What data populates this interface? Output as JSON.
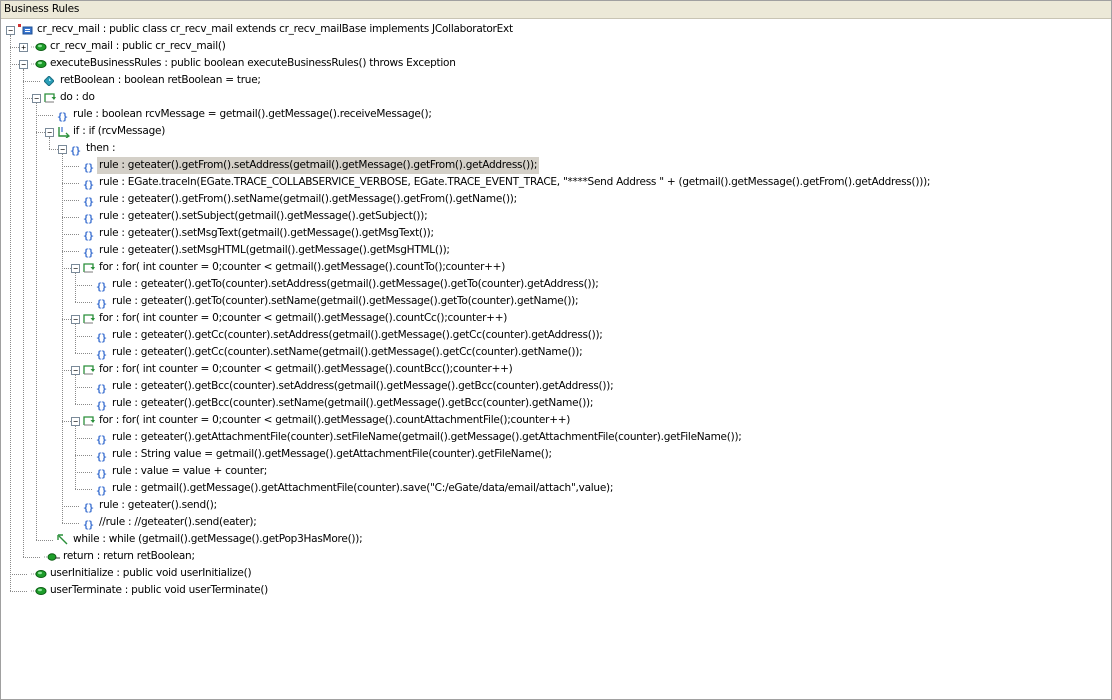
{
  "window": {
    "title": "Business Rules"
  },
  "tree": [
    {
      "id": "class",
      "depth": 0,
      "icon": "class-icon",
      "toggle": "minus",
      "text": "cr_recv_mail : public class cr_recv_mail extends cr_recv_mailBase implements JCollaboratorExt"
    },
    {
      "id": "ctor",
      "depth": 1,
      "icon": "method-icon",
      "toggle": "plus",
      "text": "cr_recv_mail : public  cr_recv_mail()"
    },
    {
      "id": "exec",
      "depth": 1,
      "icon": "method-icon",
      "toggle": "minus",
      "text": "executeBusinessRules : public boolean executeBusinessRules() throws Exception"
    },
    {
      "id": "retbool",
      "depth": 2,
      "icon": "variable-icon",
      "text": "retBoolean : boolean retBoolean = true;"
    },
    {
      "id": "do",
      "depth": 2,
      "icon": "loop-icon",
      "toggle": "minus",
      "text": "do : do"
    },
    {
      "id": "r1",
      "depth": 3,
      "icon": "rule-icon",
      "text": "rule : boolean rcvMessage = getmail().getMessage().receiveMessage();"
    },
    {
      "id": "if",
      "depth": 3,
      "icon": "if-icon",
      "toggle": "minus",
      "text": "if : if (rcvMessage)"
    },
    {
      "id": "then",
      "depth": 4,
      "icon": "rule-icon",
      "toggle": "minus",
      "text": "then :"
    },
    {
      "id": "r2",
      "depth": 5,
      "icon": "rule-icon",
      "selected": true,
      "text": "rule : geteater().getFrom().setAddress(getmail().getMessage().getFrom().getAddress());"
    },
    {
      "id": "r3",
      "depth": 5,
      "icon": "rule-icon",
      "text": "rule : EGate.traceln(EGate.TRACE_COLLABSERVICE_VERBOSE, EGate.TRACE_EVENT_TRACE, \"****Send Address \" + (getmail().getMessage().getFrom().getAddress()));"
    },
    {
      "id": "r4",
      "depth": 5,
      "icon": "rule-icon",
      "text": "rule : geteater().getFrom().setName(getmail().getMessage().getFrom().getName());"
    },
    {
      "id": "r5",
      "depth": 5,
      "icon": "rule-icon",
      "text": "rule : geteater().setSubject(getmail().getMessage().getSubject());"
    },
    {
      "id": "r6",
      "depth": 5,
      "icon": "rule-icon",
      "text": "rule : geteater().setMsgText(getmail().getMessage().getMsgText());"
    },
    {
      "id": "r7",
      "depth": 5,
      "icon": "rule-icon",
      "text": "rule : geteater().setMsgHTML(getmail().getMessage().getMsgHTML());"
    },
    {
      "id": "for1",
      "depth": 5,
      "icon": "loop-icon",
      "toggle": "minus",
      "text": "for : for( int counter = 0;counter < getmail().getMessage().countTo();counter++)"
    },
    {
      "id": "r8",
      "depth": 6,
      "icon": "rule-icon",
      "text": "rule : geteater().getTo(counter).setAddress(getmail().getMessage().getTo(counter).getAddress());"
    },
    {
      "id": "r9",
      "depth": 6,
      "icon": "rule-icon",
      "text": "rule : geteater().getTo(counter).setName(getmail().getMessage().getTo(counter).getName());"
    },
    {
      "id": "for2",
      "depth": 5,
      "icon": "loop-icon",
      "toggle": "minus",
      "text": "for : for( int counter = 0;counter < getmail().getMessage().countCc();counter++)"
    },
    {
      "id": "r10",
      "depth": 6,
      "icon": "rule-icon",
      "text": "rule : geteater().getCc(counter).setAddress(getmail().getMessage().getCc(counter).getAddress());"
    },
    {
      "id": "r11",
      "depth": 6,
      "icon": "rule-icon",
      "text": "rule : geteater().getCc(counter).setName(getmail().getMessage().getCc(counter).getName());"
    },
    {
      "id": "for3",
      "depth": 5,
      "icon": "loop-icon",
      "toggle": "minus",
      "text": "for : for( int counter = 0;counter < getmail().getMessage().countBcc();counter++)"
    },
    {
      "id": "r12",
      "depth": 6,
      "icon": "rule-icon",
      "text": "rule : geteater().getBcc(counter).setAddress(getmail().getMessage().getBcc(counter).getAddress());"
    },
    {
      "id": "r13",
      "depth": 6,
      "icon": "rule-icon",
      "text": "rule : geteater().getBcc(counter).setName(getmail().getMessage().getBcc(counter).getName());"
    },
    {
      "id": "for4",
      "depth": 5,
      "icon": "loop-icon",
      "toggle": "minus",
      "text": "for : for( int counter = 0;counter < getmail().getMessage().countAttachmentFile();counter++)"
    },
    {
      "id": "r14",
      "depth": 6,
      "icon": "rule-icon",
      "text": "rule : geteater().getAttachmentFile(counter).setFileName(getmail().getMessage().getAttachmentFile(counter).getFileName());"
    },
    {
      "id": "r15",
      "depth": 6,
      "icon": "rule-icon",
      "text": "rule : String value = getmail().getMessage().getAttachmentFile(counter).getFileName();"
    },
    {
      "id": "r16",
      "depth": 6,
      "icon": "rule-icon",
      "text": "rule : value = value + counter;"
    },
    {
      "id": "r17",
      "depth": 6,
      "icon": "rule-icon",
      "text": "rule : getmail().getMessage().getAttachmentFile(counter).save(\"C:/eGate/data/email/attach\",value);"
    },
    {
      "id": "r18",
      "depth": 5,
      "icon": "rule-icon",
      "text": "rule : geteater().send();"
    },
    {
      "id": "r19",
      "depth": 5,
      "icon": "rule-icon",
      "text": "//rule : //geteater().send(eater);"
    },
    {
      "id": "while",
      "depth": 3,
      "icon": "while-icon",
      "text": "while : while (getmail().getMessage().getPop3HasMore());"
    },
    {
      "id": "return",
      "depth": 2,
      "icon": "return-icon",
      "text": "return : return retBoolean;"
    },
    {
      "id": "uinit",
      "depth": 1,
      "icon": "method-icon",
      "text": "userInitialize : public void userInitialize()"
    },
    {
      "id": "uterm",
      "depth": 1,
      "icon": "method-icon",
      "text": "userTerminate : public void userTerminate()"
    }
  ],
  "colors": {
    "selection": "#d4d0c8",
    "method_green": "#1e9e2a",
    "rule_blue": "#3a6fd0",
    "variable_teal": "#2a9fb8",
    "loop_green": "#2a8f3a"
  }
}
